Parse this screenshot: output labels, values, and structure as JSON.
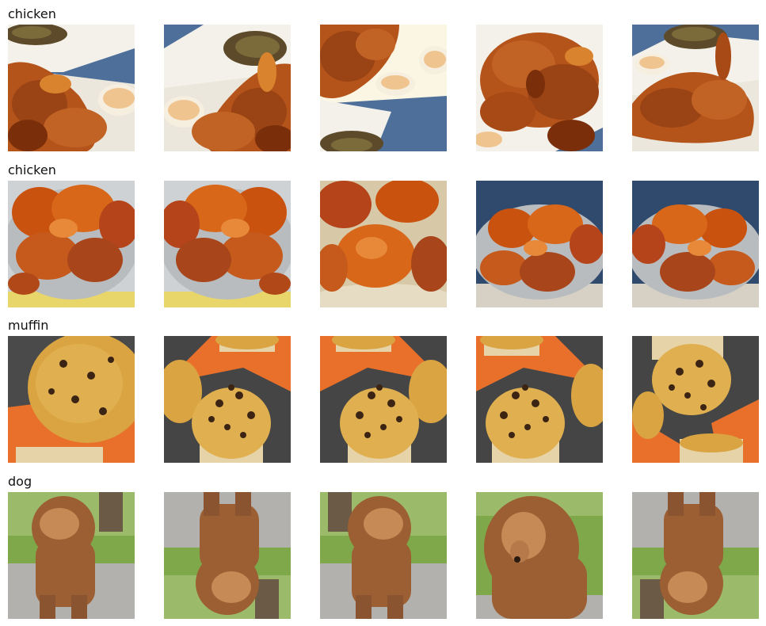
{
  "rows": [
    {
      "label": "chicken",
      "subject": "fried-chicken",
      "tiles": [
        {
          "variant": "original",
          "scene": "fried chicken on white plate with sauce cups"
        },
        {
          "variant": "flipped-horizontal",
          "scene": "fried chicken on white plate with sauce cups"
        },
        {
          "variant": "rotated-180",
          "scene": "fried chicken on white plate with sauce cups"
        },
        {
          "variant": "zoomed-crop",
          "scene": "fried chicken pieces close up"
        },
        {
          "variant": "flipped-horizontal",
          "scene": "fried chicken on white plate"
        }
      ]
    },
    {
      "label": "chicken",
      "subject": "fried-chicken-platter",
      "tiles": [
        {
          "variant": "rotated-180",
          "scene": "fried chicken on silver platter"
        },
        {
          "variant": "rotated-180-flipped",
          "scene": "fried chicken on silver platter"
        },
        {
          "variant": "zoomed-crop",
          "scene": "fried chicken close up"
        },
        {
          "variant": "original",
          "scene": "fried chicken on silver platter"
        },
        {
          "variant": "flipped-horizontal",
          "scene": "fried chicken on silver platter"
        }
      ]
    },
    {
      "label": "muffin",
      "subject": "chocolate-chip-muffin",
      "tiles": [
        {
          "variant": "zoomed-rotated",
          "scene": "chocolate chip muffin top on orange cloth"
        },
        {
          "variant": "original",
          "scene": "chocolate chip muffins on slate with orange cloth"
        },
        {
          "variant": "flipped-horizontal",
          "scene": "chocolate chip muffins on slate with orange cloth"
        },
        {
          "variant": "original-shifted",
          "scene": "chocolate chip muffins on slate with orange cloth"
        },
        {
          "variant": "rotated-180",
          "scene": "chocolate chip muffins on slate with orange cloth"
        }
      ]
    },
    {
      "label": "dog",
      "subject": "brown-poodle",
      "tiles": [
        {
          "variant": "original",
          "scene": "brown poodle standing in park"
        },
        {
          "variant": "flipped-vertical",
          "scene": "brown poodle standing in park"
        },
        {
          "variant": "original",
          "scene": "brown poodle standing in park"
        },
        {
          "variant": "zoomed-crop",
          "scene": "brown poodle head close up"
        },
        {
          "variant": "flipped-vertical",
          "scene": "brown poodle standing in park"
        }
      ]
    }
  ],
  "colors": {
    "chicken_dark": "#7a2f0a",
    "chicken_mid": "#b5541a",
    "chicken_light": "#d9832e",
    "plate": "#f4f1ea",
    "blue_bg": "#4d6f99",
    "muffin": "#d9a441",
    "muffin_light": "#e8c470",
    "chip": "#3b2414",
    "orange_cloth": "#e8702a",
    "slate": "#454545",
    "poodle": "#9c5f33",
    "poodle_light": "#c58a55",
    "grass": "#7fa84a",
    "path": "#b3b1ad"
  }
}
